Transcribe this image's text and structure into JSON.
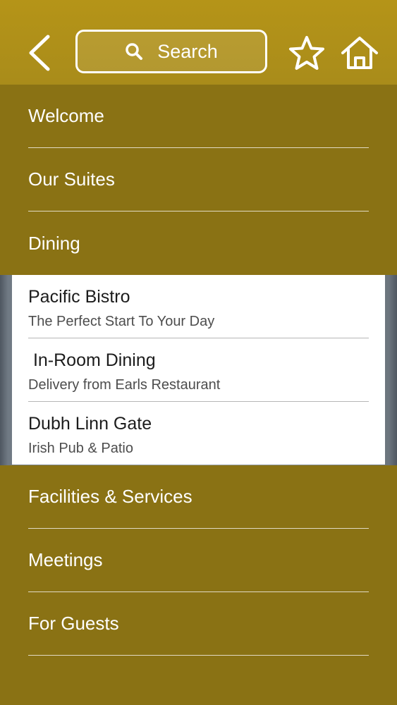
{
  "header": {
    "search_label": "Search",
    "icons": [
      "back-chevron-icon",
      "search-icon",
      "star-icon",
      "home-icon"
    ]
  },
  "menu": {
    "upper": [
      {
        "label": "Welcome"
      },
      {
        "label": "Our Suites"
      },
      {
        "label": "Dining"
      }
    ],
    "dining_submenu": [
      {
        "title": "Pacific Bistro",
        "description": "The Perfect Start To Your Day"
      },
      {
        "title": " In-Room Dining",
        "description": "Delivery from Earls Restaurant"
      },
      {
        "title": "Dubh Linn Gate",
        "description": "Irish Pub & Patio"
      }
    ],
    "lower": [
      {
        "label": "Facilities & Services"
      },
      {
        "label": "Meetings"
      },
      {
        "label": "For Guests"
      }
    ]
  },
  "colors": {
    "topbar": "#b08f18",
    "menu_background": "#8a7214",
    "text_light": "#ffffff",
    "submenu_background": "#ffffff"
  }
}
